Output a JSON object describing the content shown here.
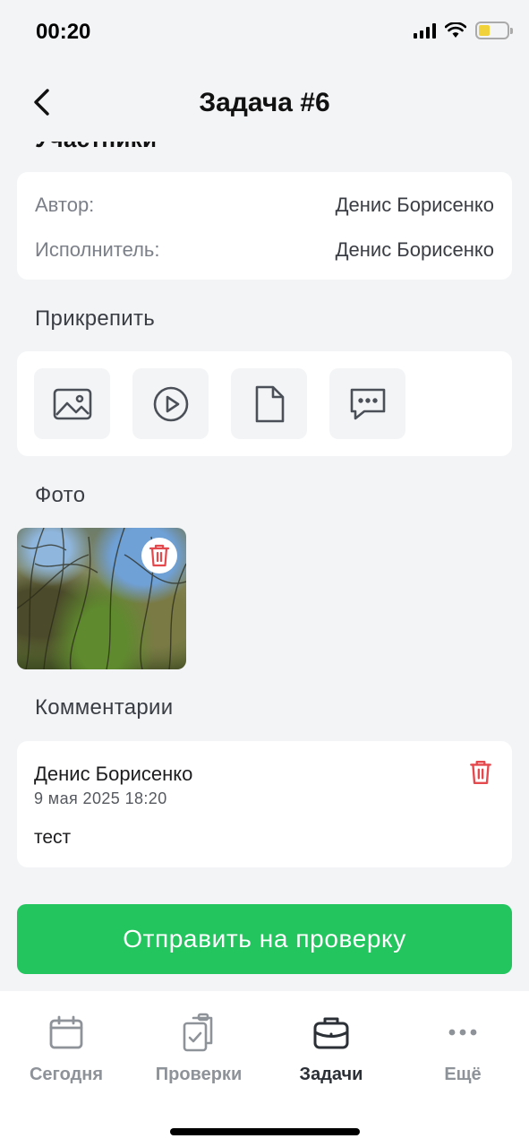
{
  "status": {
    "time": "00:20"
  },
  "header": {
    "title": "Задача #6"
  },
  "participants": {
    "section_title": "Участники",
    "author_label": "Автор:",
    "author_value": "Денис Борисенко",
    "executor_label": "Исполнитель:",
    "executor_value": "Денис Борисенко"
  },
  "attach": {
    "section_title": "Прикрепить",
    "buttons": [
      {
        "icon": "image-icon"
      },
      {
        "icon": "video-play-icon"
      },
      {
        "icon": "document-icon"
      },
      {
        "icon": "comment-icon"
      }
    ]
  },
  "photos": {
    "section_title": "Фото"
  },
  "comments": {
    "section_title": "Комментарии",
    "items": [
      {
        "author": "Денис Борисенко",
        "date": "9 мая 2025 18:20",
        "text": "тест"
      }
    ]
  },
  "submit_label": "Отправить на проверку",
  "tabs": [
    {
      "label": "Сегодня",
      "icon": "calendar-icon",
      "active": false
    },
    {
      "label": "Проверки",
      "icon": "clipboard-check-icon",
      "active": false
    },
    {
      "label": "Задачи",
      "icon": "briefcase-icon",
      "active": true
    },
    {
      "label": "Ещё",
      "icon": "more-dots-icon",
      "active": false
    }
  ],
  "colors": {
    "accent": "#22c55e",
    "danger": "#e5484d",
    "background": "#f3f4f6"
  }
}
